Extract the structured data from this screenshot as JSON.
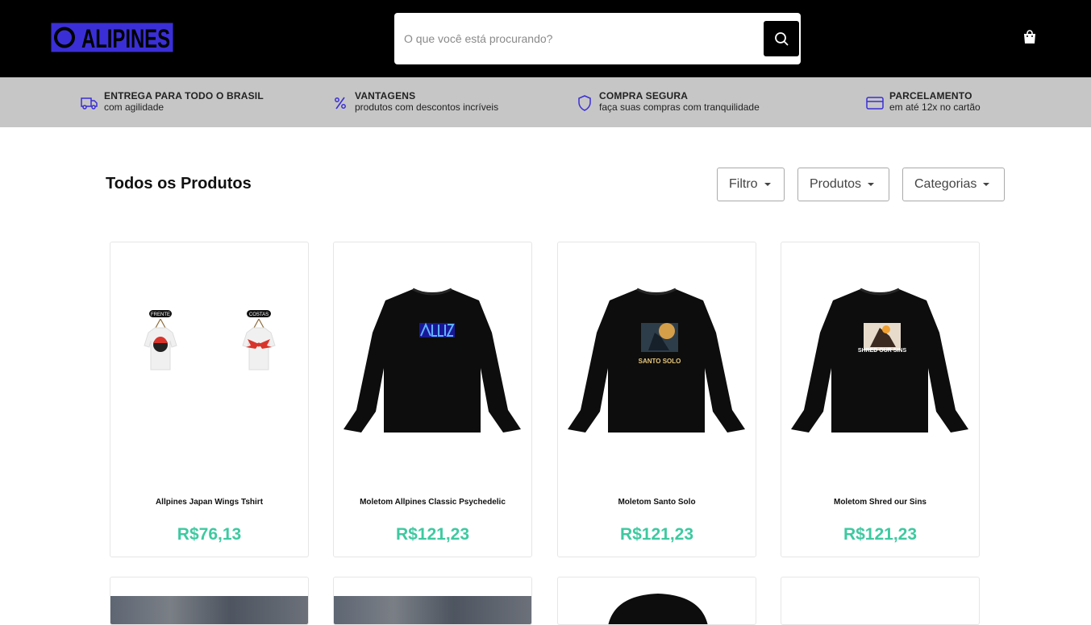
{
  "brand": {
    "logo_text": "ALIPINES",
    "accent": "#3a2fd6"
  },
  "search": {
    "placeholder": "O que você está procurando?",
    "icon": "search-icon"
  },
  "cart": {
    "icon": "shopping-bag-icon"
  },
  "benefits": [
    {
      "icon": "truck-icon",
      "title": "ENTREGA PARA TODO O BRASIL",
      "subtitle": "com agilidade"
    },
    {
      "icon": "percent-icon",
      "title": "VANTAGENS",
      "subtitle": "produtos com descontos incríveis"
    },
    {
      "icon": "shield-icon",
      "title": "COMPRA SEGURA",
      "subtitle": "faça suas compras com tranquilidade"
    },
    {
      "icon": "credit-card-icon",
      "title": "PARCELAMENTO",
      "subtitle": "em até 12x no cartão"
    }
  ],
  "main": {
    "title": "Todos os Produtos",
    "filters": [
      {
        "label": "Filtro"
      },
      {
        "label": "Produtos"
      },
      {
        "label": "Categorias"
      }
    ]
  },
  "products": [
    {
      "name": "Allpines Japan Wings Tshirt",
      "price": "R$76,13",
      "image": "tshirt-front-back"
    },
    {
      "name": "Moletom Allpines Classic Psychedelic",
      "price": "R$121,23",
      "image": "black-sweatshirt"
    },
    {
      "name": "Moletom Santo Solo",
      "price": "R$121,23",
      "image": "black-sweatshirt",
      "print_text": "SANTO SOLO"
    },
    {
      "name": "Moletom Shred our Sins",
      "price": "R$121,23",
      "image": "black-sweatshirt",
      "print_text": "SHRED OUR SINS"
    }
  ],
  "tshirt_tags": {
    "front": "FRENTE",
    "back": "COSTAS"
  },
  "colors": {
    "header_bg": "#000000",
    "benefits_bg": "#c6c6c6",
    "price": "#3ec9a0",
    "icon_blue": "#3a2fd6"
  }
}
